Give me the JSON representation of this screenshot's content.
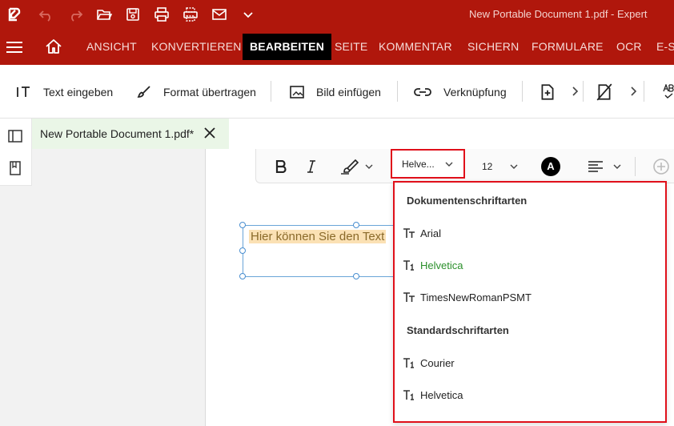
{
  "titlebar": {
    "title": "New Portable Document 1.pdf   -   Expert"
  },
  "tabs": {
    "items": [
      "ANSICHT",
      "KONVERTIEREN",
      "BEARBEITEN",
      "SEITE",
      "KOMMENTAR",
      "SICHERN",
      "FORMULARE",
      "OCR",
      "E-S"
    ],
    "active": "BEARBEITEN"
  },
  "toolbar": {
    "text_input": "Text eingeben",
    "format_painter": "Format übertragen",
    "insert_image": "Bild einfügen",
    "link": "Verknüpfung"
  },
  "document": {
    "tab_title": "New Portable Document 1.pdf*",
    "textbox_text": "Hier können Sie den Text"
  },
  "text_toolbar": {
    "font": "Helve...",
    "size": "12",
    "color_badge": "A"
  },
  "font_dropdown": {
    "section_document": "Dokumentenschriftarten",
    "document_fonts": [
      "Arial",
      "Helvetica",
      "TimesNewRomanPSMT"
    ],
    "section_standard": "Standardschriftarten",
    "standard_fonts": [
      "Courier",
      "Helvetica"
    ],
    "selected": "Helvetica"
  },
  "colors": {
    "brand_red": "#b0170c",
    "highlight_red": "#e0101a",
    "selected_green": "#2a8f2a"
  }
}
